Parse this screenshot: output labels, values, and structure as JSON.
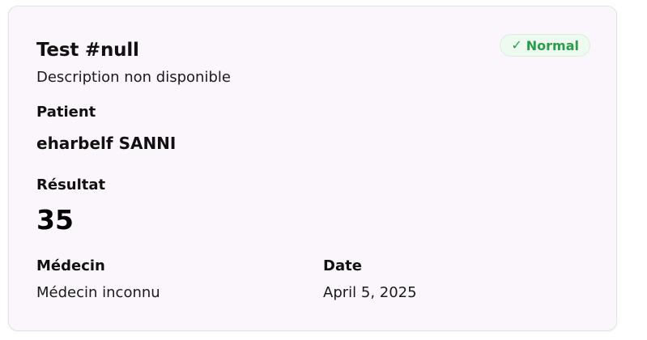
{
  "test": {
    "title": "Test #null",
    "description": "Description non disponible",
    "status": {
      "check_glyph": "✓",
      "label": "Normal",
      "color": "#2a9d4a"
    }
  },
  "patient": {
    "label": "Patient",
    "name": "eharbelf SANNI"
  },
  "result": {
    "label": "Résultat",
    "value": "35"
  },
  "doctor": {
    "label": "Médecin",
    "value": "Médecin inconnu"
  },
  "date": {
    "label": "Date",
    "value": "April 5, 2025"
  }
}
